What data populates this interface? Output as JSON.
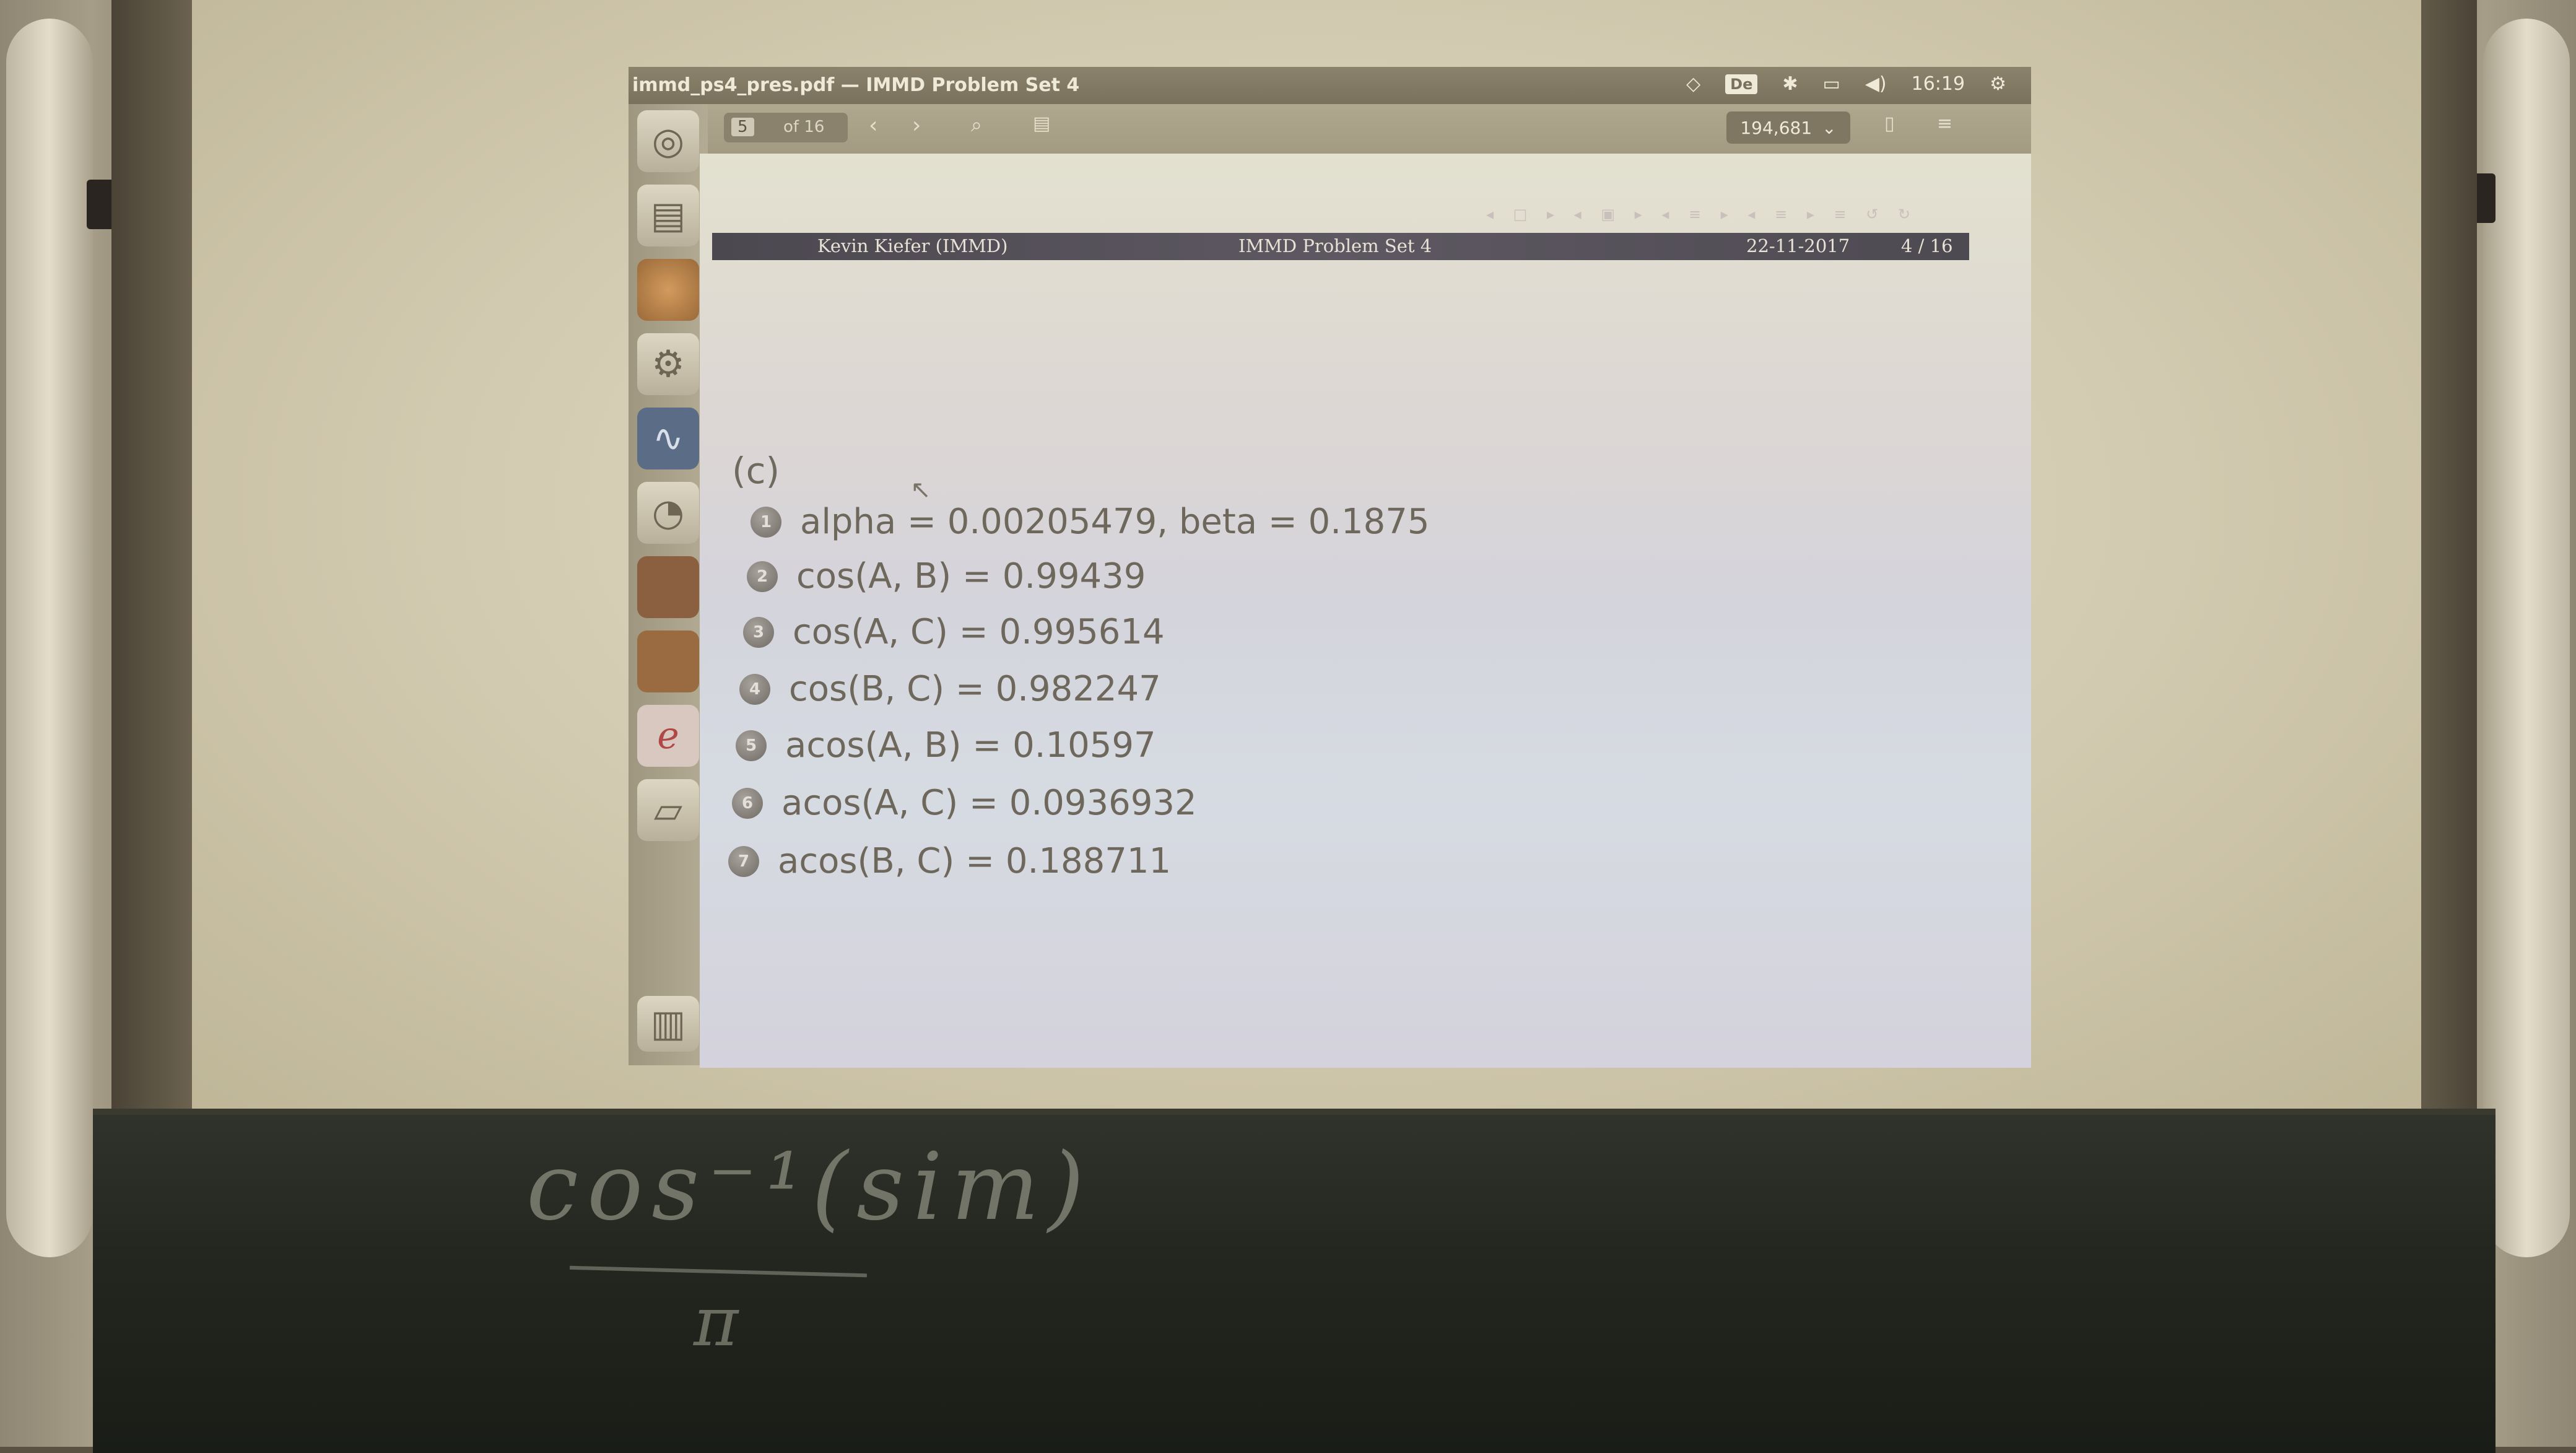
{
  "window": {
    "title": "immd_ps4_pres.pdf — IMMD Problem Set 4",
    "keyboard_layout": "De",
    "time": "16:19"
  },
  "toolbar": {
    "page_current": "5",
    "page_total": "of 16",
    "zoom": "194,681"
  },
  "slide": {
    "header": {
      "author": "Kevin Kiefer  (IMMD)",
      "title": "IMMD Problem Set 4",
      "date": "22-11-2017",
      "pages": "4  /  16"
    },
    "section": "(c)",
    "items": [
      {
        "num": "1",
        "text": "alpha = 0.00205479, beta = 0.1875"
      },
      {
        "num": "2",
        "text": "cos(A, B) = 0.99439"
      },
      {
        "num": "3",
        "text": "cos(A, C) = 0.995614"
      },
      {
        "num": "4",
        "text": "cos(B, C) = 0.982247"
      },
      {
        "num": "5",
        "text": "acos(A, B) = 0.10597"
      },
      {
        "num": "6",
        "text": "acos(A, C) = 0.0936932"
      },
      {
        "num": "7",
        "text": "acos(B, C) = 0.188711"
      }
    ]
  },
  "chalkboard": {
    "top": "cos⁻¹(sim)",
    "bottom": "π"
  },
  "icons": [
    "wifi-icon",
    "bluetooth-icon",
    "battery-icon",
    "volume-icon",
    "settings-icon",
    "search-icon",
    "prev-page-icon",
    "next-page-icon",
    "sidebar-toggle-icon",
    "annotate-icon",
    "menu-icon"
  ]
}
